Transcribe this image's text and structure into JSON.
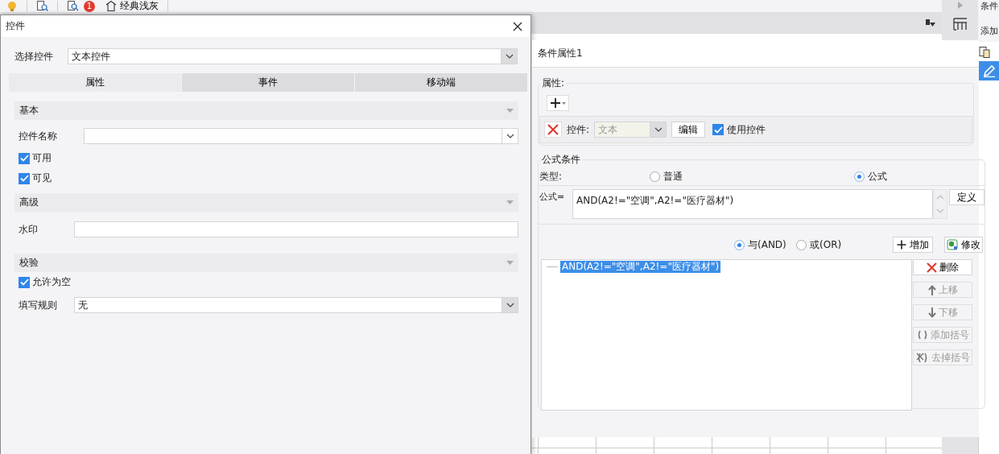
{
  "toolbar": {
    "badge": "1",
    "theme_button": "经典浅灰"
  },
  "side_panel": {
    "labels": [
      "条件",
      "添加"
    ]
  },
  "control_dialog": {
    "title": "控件",
    "select_label": "选择控件",
    "select_value": "文本控件",
    "tabs": [
      {
        "label": "属性",
        "selected": true
      },
      {
        "label": "事件",
        "selected": false
      },
      {
        "label": "移动端",
        "selected": false
      }
    ],
    "sections": [
      {
        "title": "基本",
        "rows": [
          {
            "kind": "combo",
            "label": "控件名称"
          },
          {
            "kind": "checkbox",
            "label": "可用",
            "checked": true
          },
          {
            "kind": "checkbox",
            "label": "可见",
            "checked": true
          }
        ]
      },
      {
        "title": "高级",
        "rows": [
          {
            "kind": "text",
            "label": "水印"
          }
        ]
      },
      {
        "title": "校验",
        "rows": [
          {
            "kind": "checkbox",
            "label": "允许为空",
            "checked": true
          },
          {
            "kind": "combo",
            "label": "填写规则",
            "value": "无"
          }
        ]
      }
    ]
  },
  "condition_panel": {
    "title": "条件属性1",
    "attributes": {
      "legend": "属性:",
      "control_label": "控件:",
      "control_value": "文本",
      "edit_button": "编辑",
      "use_control": {
        "label": "使用控件",
        "checked": true
      }
    },
    "formula": {
      "legend": "公式条件",
      "type_label": "类型:",
      "types": [
        {
          "label": "普通",
          "selected": false
        },
        {
          "label": "公式",
          "selected": true
        }
      ],
      "formula_label": "公式=",
      "formula_value": "AND(A2!=\"空调\",A2!=\"医疗器材\")",
      "define_button": "定义",
      "logic": [
        {
          "label": "与(AND)",
          "selected": true
        },
        {
          "label": "或(OR)",
          "selected": false
        }
      ],
      "add_button": "增加",
      "modify_button": "修改",
      "conditions": [
        {
          "text": "AND(A2!=\"空调\",A2!=\"医疗器材\")",
          "selected": true
        }
      ],
      "side_buttons": [
        {
          "kind": "delete",
          "label": "删除",
          "disabled": false
        },
        {
          "kind": "up",
          "label": "上移",
          "disabled": true
        },
        {
          "kind": "down",
          "label": "下移",
          "disabled": true
        },
        {
          "kind": "add_parens",
          "label": "添加括号",
          "disabled": true
        },
        {
          "kind": "remove_parens",
          "label": "去掉括号",
          "disabled": true
        }
      ]
    }
  }
}
